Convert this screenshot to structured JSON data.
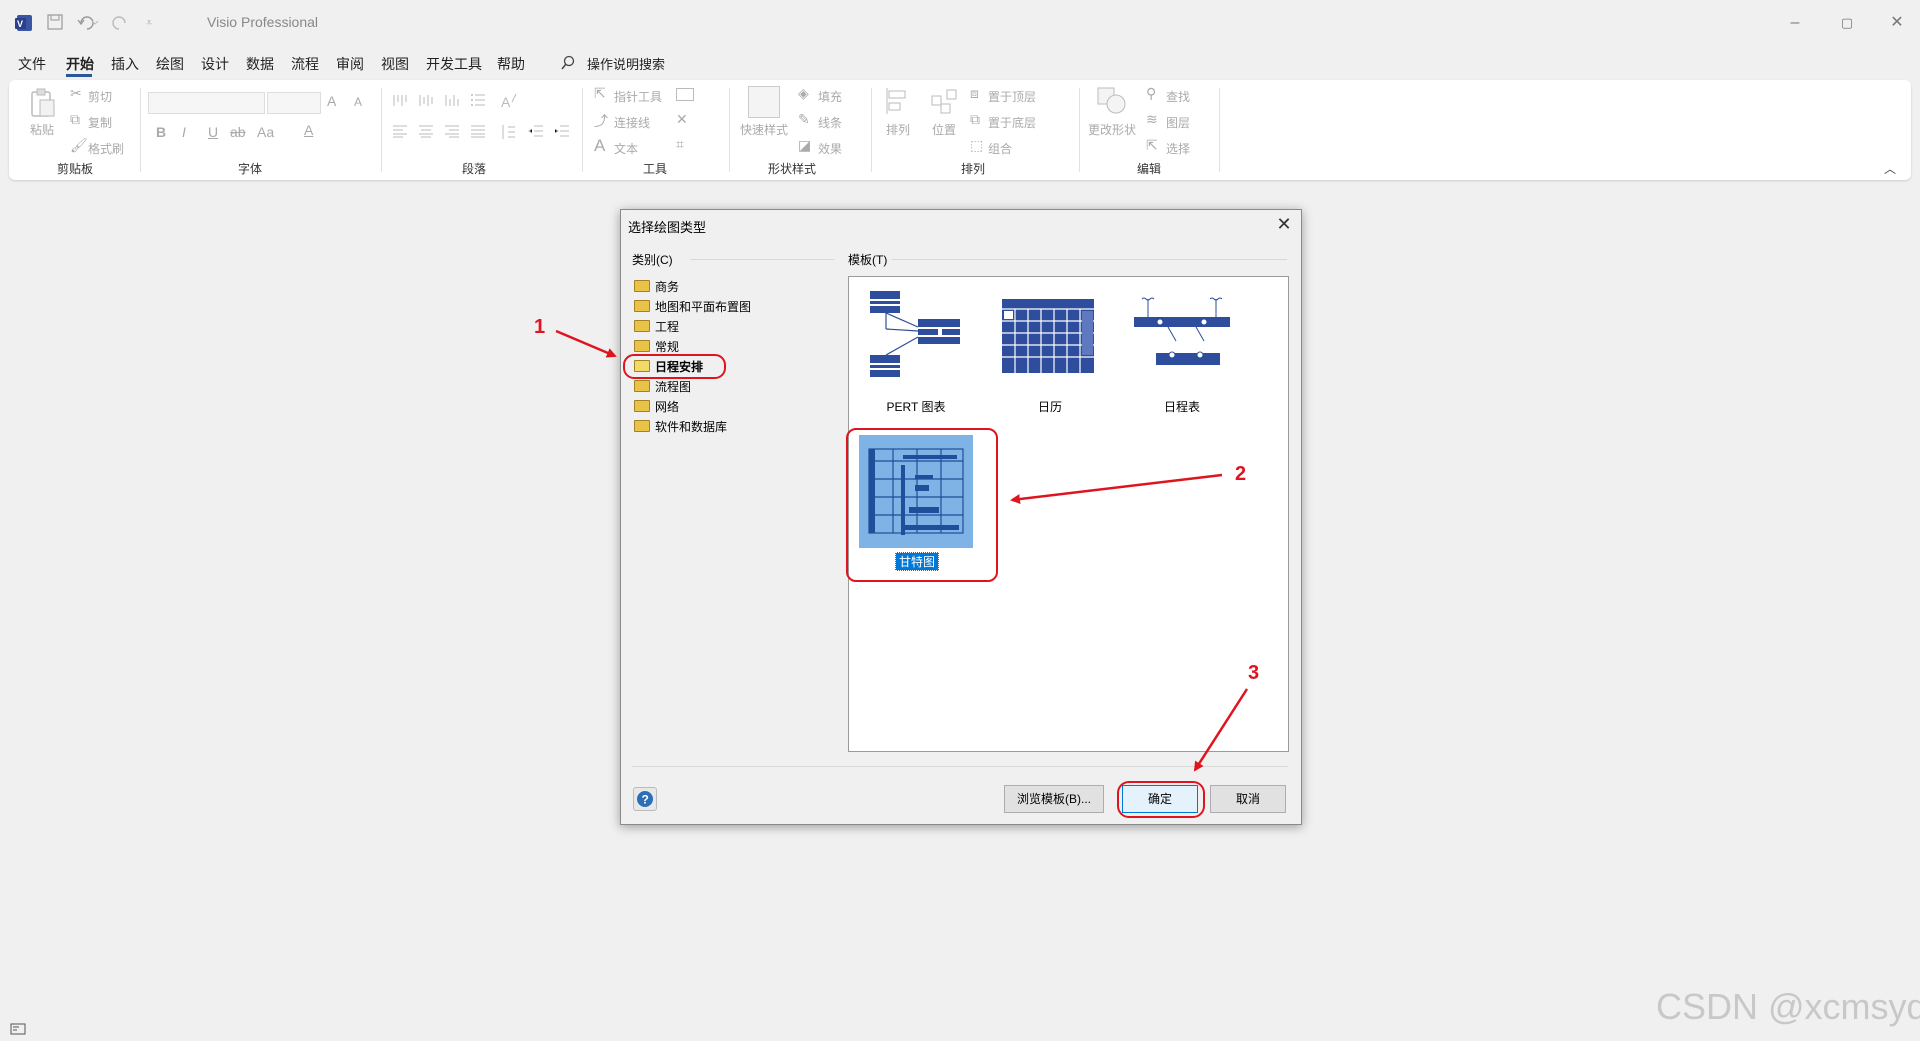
{
  "app": {
    "title": "Visio Professional"
  },
  "menu": [
    "文件",
    "开始",
    "插入",
    "绘图",
    "设计",
    "数据",
    "流程",
    "审阅",
    "视图",
    "开发工具",
    "帮助"
  ],
  "tell_me": "操作说明搜索",
  "ribbon": {
    "clipboard": {
      "paste": "粘贴",
      "cut": "剪切",
      "copy": "复制",
      "format_painter": "格式刷",
      "label": "剪贴板"
    },
    "font": {
      "label": "字体",
      "bold": "B",
      "italic": "I",
      "underline": "U",
      "strike": "ab",
      "case": "Aa",
      "color": "A",
      "grow": "A",
      "shrink": "A"
    },
    "paragraph": {
      "label": "段落"
    },
    "tools": {
      "pointer": "指针工具",
      "connector": "连接线",
      "text": "文本",
      "label": "工具"
    },
    "shape_styles": {
      "quick": "快速样式",
      "fill": "填充",
      "line": "线条",
      "effect": "效果",
      "label": "形状样式"
    },
    "arrange": {
      "align": "排列",
      "position": "位置",
      "front": "置于顶层",
      "back": "置于底层",
      "group": "组合",
      "label": "排列"
    },
    "editing": {
      "change_shape": "更改形状",
      "find": "查找",
      "layers": "图层",
      "select": "选择",
      "label": "编辑"
    }
  },
  "dialog": {
    "title": "选择绘图类型",
    "category_label": "类别(C)",
    "template_label": "模板(T)",
    "categories": [
      "商务",
      "地图和平面布置图",
      "工程",
      "常规",
      "日程安排",
      "流程图",
      "网络",
      "软件和数据库"
    ],
    "templates": [
      "PERT 图表",
      "日历",
      "日程表",
      "甘特图"
    ],
    "browse_button": "浏览模板(B)...",
    "ok_button": "确定",
    "cancel_button": "取消"
  },
  "annotations": [
    "1",
    "2",
    "3"
  ],
  "watermark": "CSDN @xcmsyd",
  "colors": {
    "accent": "#2b579a",
    "annotation": "#e0141e",
    "template_blue": "#2e4d9c",
    "selection": "#0078d7"
  }
}
